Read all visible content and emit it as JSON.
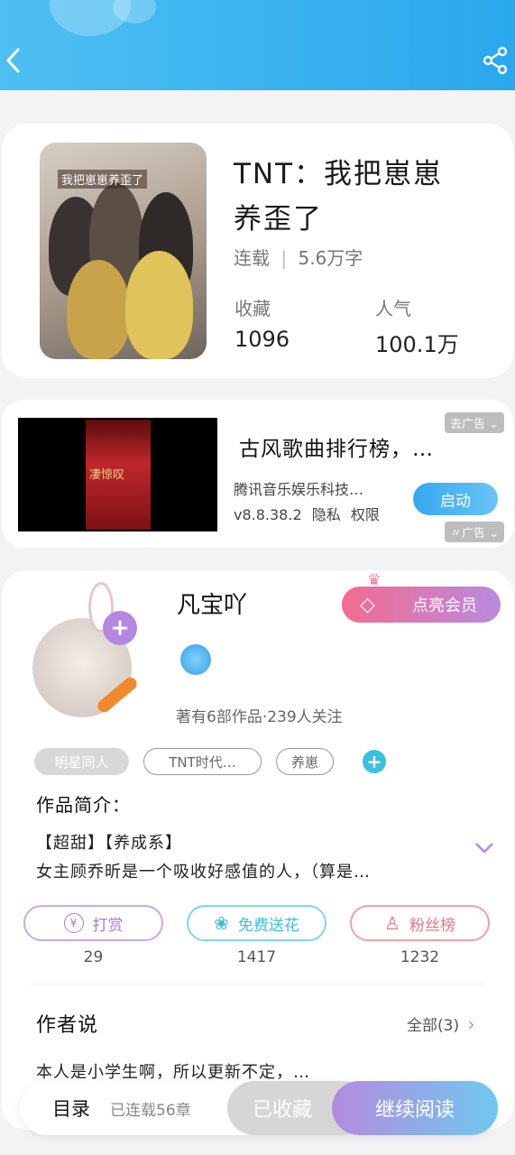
{
  "book": {
    "title_line1": "TNT：我把崽崽",
    "title_line2": "养歪了",
    "status": "连载",
    "word_count": "5.6万字",
    "stats": [
      {
        "label": "收藏",
        "value": "1096"
      },
      {
        "label": "人气",
        "value": "100.1万"
      }
    ],
    "cover_text": "我把崽崽养歪了"
  },
  "ad": {
    "title": "古风歌曲排行榜，…",
    "publisher": "腾讯音乐娱乐科技…",
    "version": "v8.8.38.2",
    "privacy": "隐私",
    "permissions": "权限",
    "button": "启动",
    "remove_label": "去广告",
    "ad_label": "广告",
    "poster_text": "凄惊叹"
  },
  "author": {
    "name": "凡宝吖",
    "info": "著有6部作品·239人关注",
    "vip_button": "点亮会员"
  },
  "tags": [
    "明星同人",
    "TNT时代…",
    "养崽"
  ],
  "intro": {
    "heading": "作品简介：",
    "line1": "【超甜】【养成系】",
    "line2": "女主顾乔昕是一个吸收好感值的人，（算是…"
  },
  "actions": [
    {
      "label": "打赏",
      "count": "29"
    },
    {
      "label": "免费送花",
      "count": "1417"
    },
    {
      "label": "粉丝榜",
      "count": "1232"
    }
  ],
  "author_says": {
    "heading": "作者说",
    "all_label": "全部(3)",
    "text": "本人是小学生啊，所以更新不定，…"
  },
  "bottom": {
    "toc": "目录",
    "toc_sub": "已连载56章",
    "collected": "已收藏",
    "continue": "继续阅读"
  },
  "colors": {
    "header": "#2aa8ee",
    "accent_purple": "#a57be0",
    "accent_cyan": "#3cc0e0",
    "accent_red": "#e9767d"
  }
}
